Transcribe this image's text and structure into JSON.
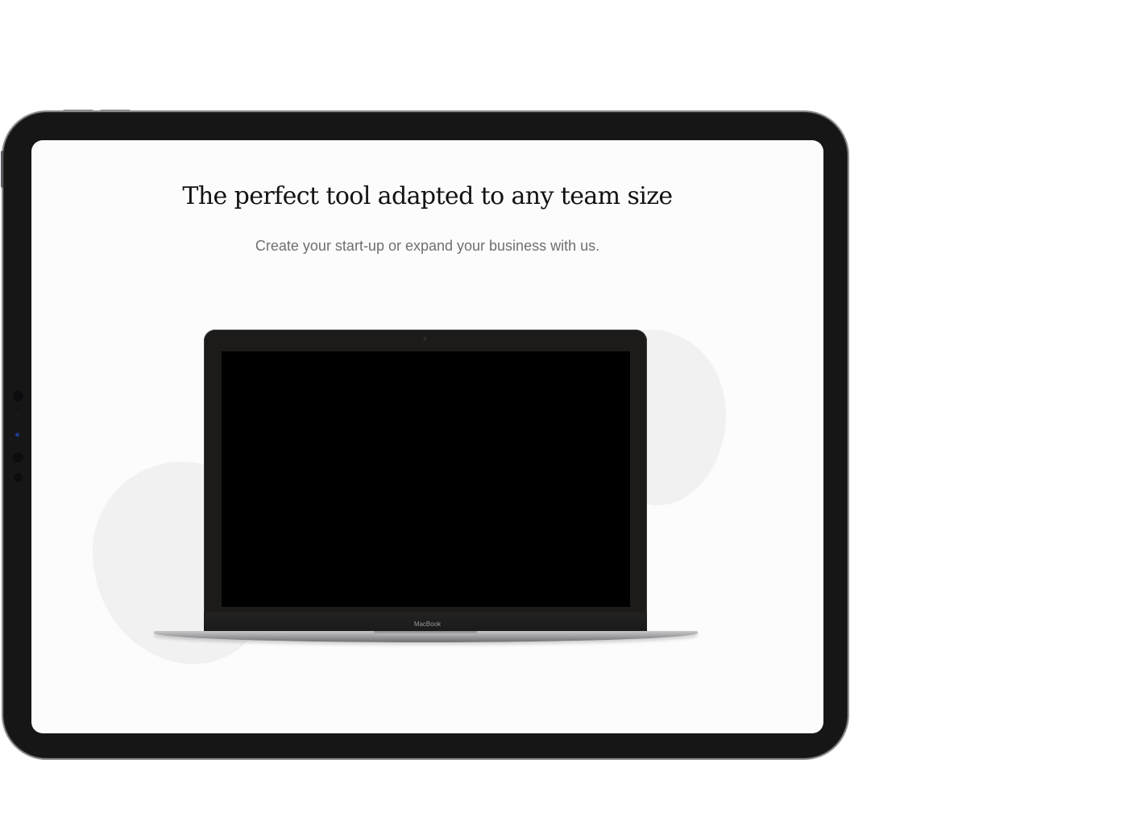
{
  "headline": "The perfect tool adapted to any team size",
  "subtitle": "Create your start-up or expand your business with us.",
  "laptop": {
    "brand_label": "MacBook"
  },
  "colors": {
    "frame": "#161616",
    "screen_background": "#fcfcfc",
    "headline_text": "#121212",
    "subtitle_text": "#6f6f6f",
    "blob": "#f1f1f1"
  }
}
